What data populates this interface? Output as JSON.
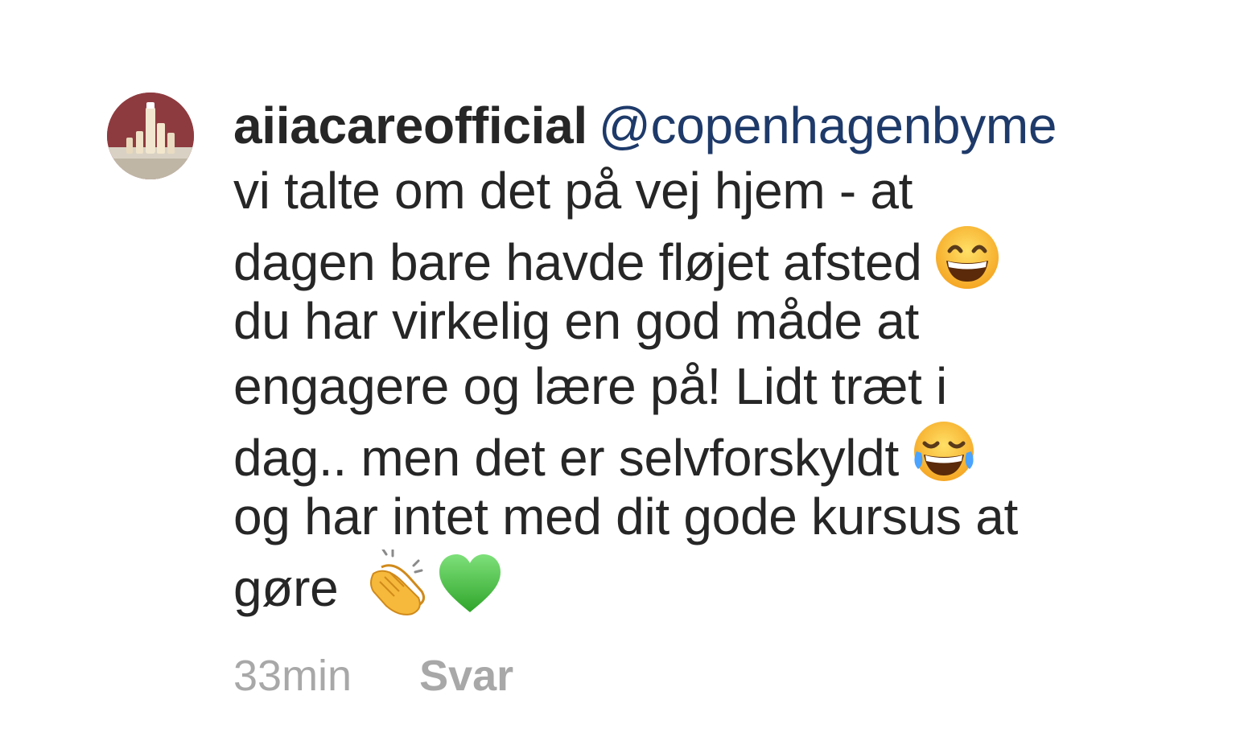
{
  "comment": {
    "username": "aiiacareofficial",
    "mention": "@copenhagenbyme",
    "lines": [
      "vi talte om det på vej hjem - at",
      "dagen bare havde fløjet afsted",
      "du har virkelig en god måde at",
      "engagere og lære på! Lidt træt i",
      "dag.. men det er selvforskyldt",
      "og har intet med dit gode kursus at",
      "gøre"
    ],
    "emojis": {
      "line2": "grinning-face-smiling-eyes-icon",
      "line5": "face-with-tears-of-joy-icon",
      "line7": [
        "clapping-hands-icon",
        "green-heart-icon"
      ]
    }
  },
  "meta": {
    "time": "33min",
    "reply_label": "Svar"
  },
  "colors": {
    "text": "#262626",
    "mention": "#1e3a6a",
    "meta": "#a8a8a8",
    "avatar_bg": "#8e3b3f"
  }
}
